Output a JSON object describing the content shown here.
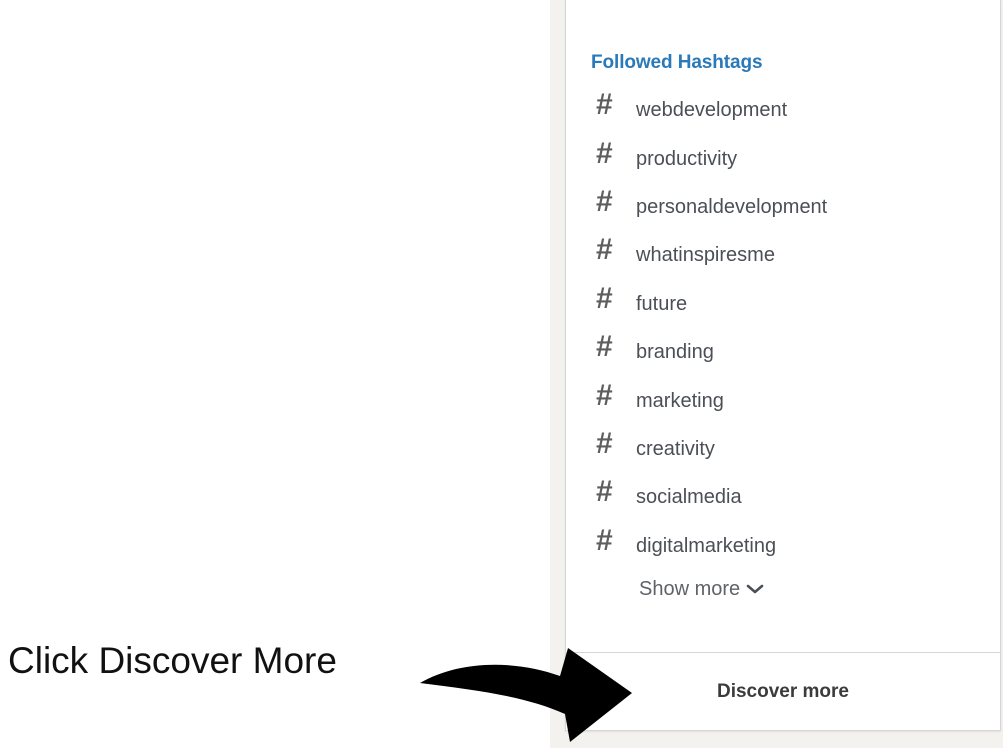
{
  "panel": {
    "title": "Followed Hashtags",
    "hashtags": [
      {
        "icon": "#",
        "label": "webdevelopment"
      },
      {
        "icon": "#",
        "label": "productivity"
      },
      {
        "icon": "#",
        "label": "personaldevelopment"
      },
      {
        "icon": "#",
        "label": "whatinspiresme"
      },
      {
        "icon": "#",
        "label": "future"
      },
      {
        "icon": "#",
        "label": "branding"
      },
      {
        "icon": "#",
        "label": "marketing"
      },
      {
        "icon": "#",
        "label": "creativity"
      },
      {
        "icon": "#",
        "label": "socialmedia"
      },
      {
        "icon": "#",
        "label": "digitalmarketing"
      }
    ],
    "show_more_label": "Show more",
    "discover_label": "Discover more"
  },
  "annotation": {
    "text": "Click Discover More",
    "arrow_icon": "curved-arrow-icon"
  },
  "colors": {
    "title_blue": "#2a79b8",
    "text_gray": "#4b4f56",
    "border_gray": "#d6d6d6"
  }
}
